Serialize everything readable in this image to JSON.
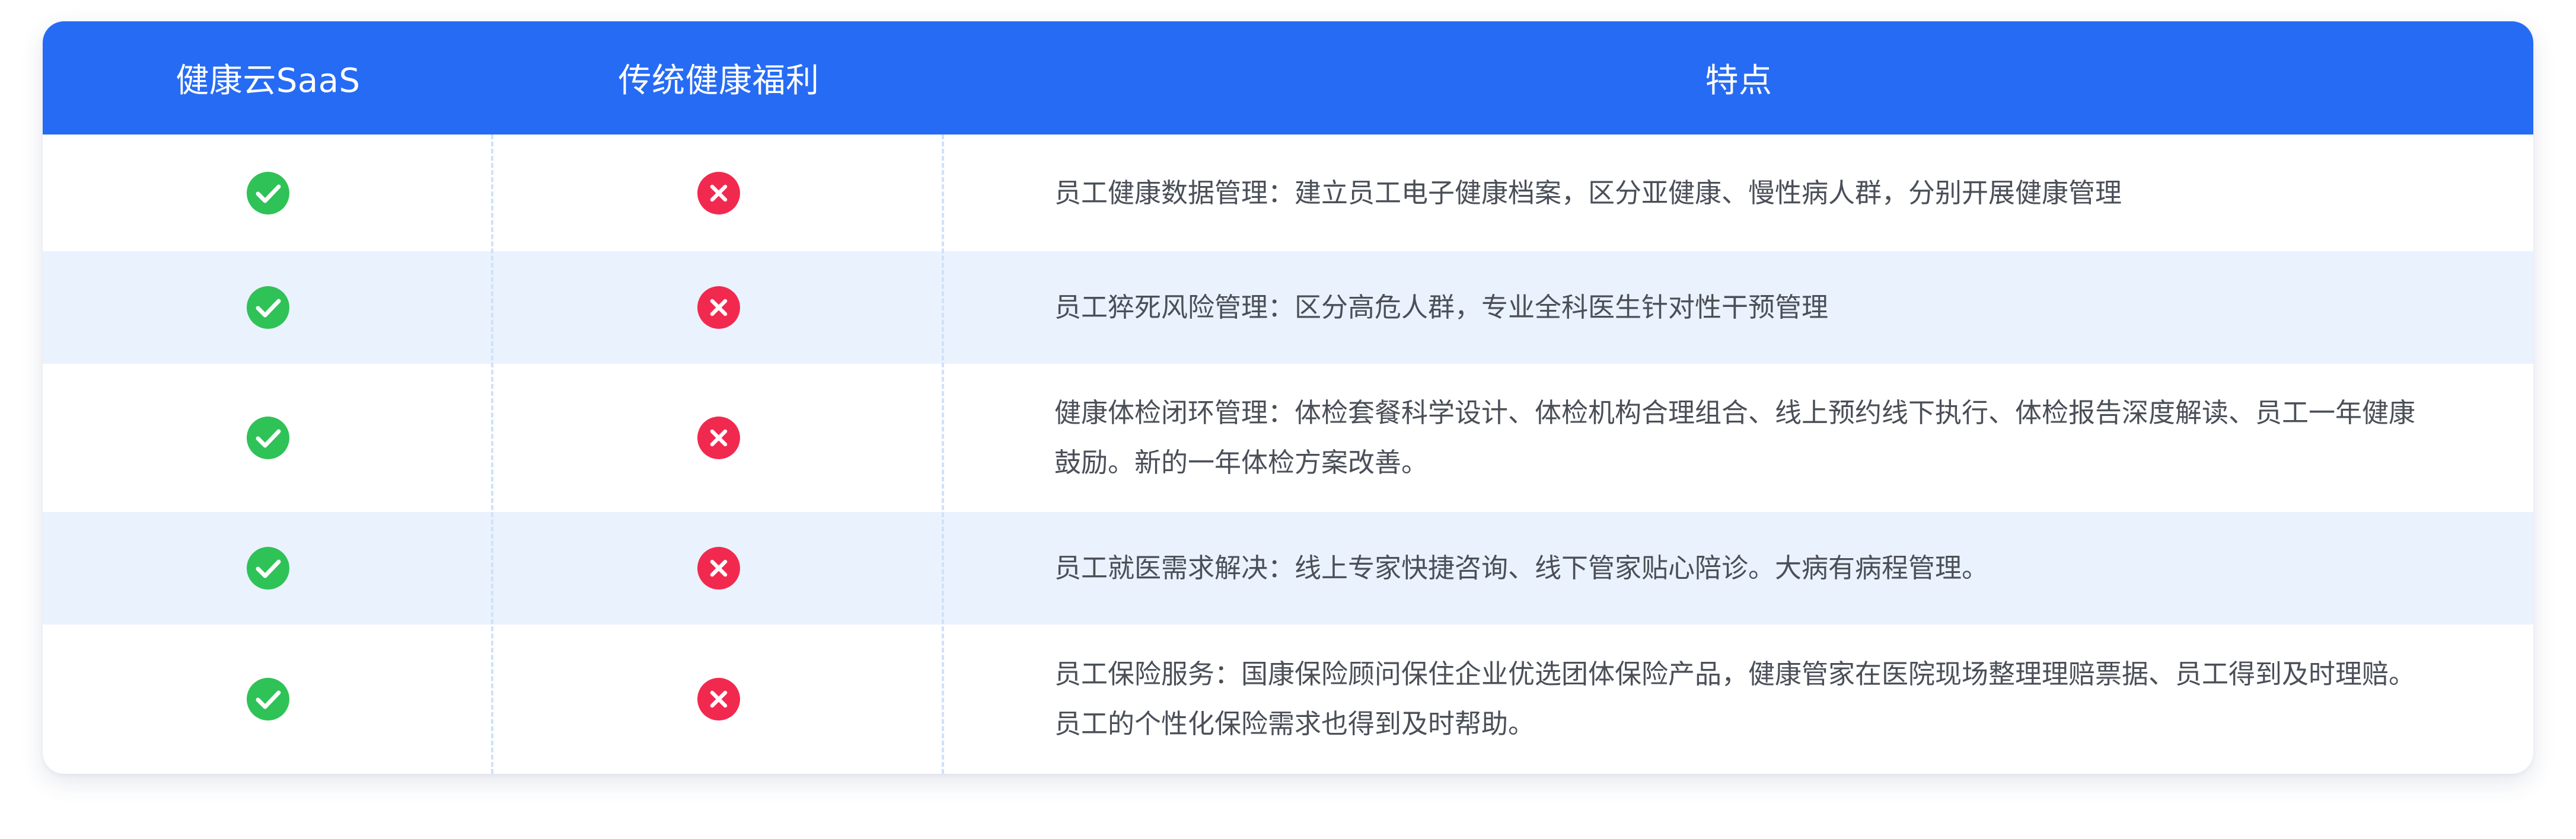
{
  "header": {
    "col1": "健康云SaaS",
    "col2": "传统健康福利",
    "col3": "特点"
  },
  "colors": {
    "header_bg": "#266bf4",
    "header_text": "#ffffff",
    "row_alt_bg": "#eaf2fe",
    "check_green": "#2fc257",
    "cross_red": "#f2294f",
    "divider": "#cfe1fb",
    "body_text": "#4a4f58"
  },
  "rows": [
    {
      "saas": "check-icon",
      "traditional": "cross-icon",
      "feature": "员工健康数据管理：建立员工电子健康档案，区分亚健康、慢性病人群，分别开展健康管理"
    },
    {
      "saas": "check-icon",
      "traditional": "cross-icon",
      "feature": "员工猝死风险管理：区分高危人群，专业全科医生针对性干预管理"
    },
    {
      "saas": "check-icon",
      "traditional": "cross-icon",
      "feature": "健康体检闭环管理：体检套餐科学设计、体检机构合理组合、线上预约线下执行、体检报告深度解读、员工一年健康鼓励。新的一年体检方案改善。"
    },
    {
      "saas": "check-icon",
      "traditional": "cross-icon",
      "feature": "员工就医需求解决：线上专家快捷咨询、线下管家贴心陪诊。大病有病程管理。"
    },
    {
      "saas": "check-icon",
      "traditional": "cross-icon",
      "feature": "员工保险服务：国康保险顾问保住企业优选团体保险产品，健康管家在医院现场整理理赔票据、员工得到及时理赔。员工的个性化保险需求也得到及时帮助。"
    }
  ]
}
